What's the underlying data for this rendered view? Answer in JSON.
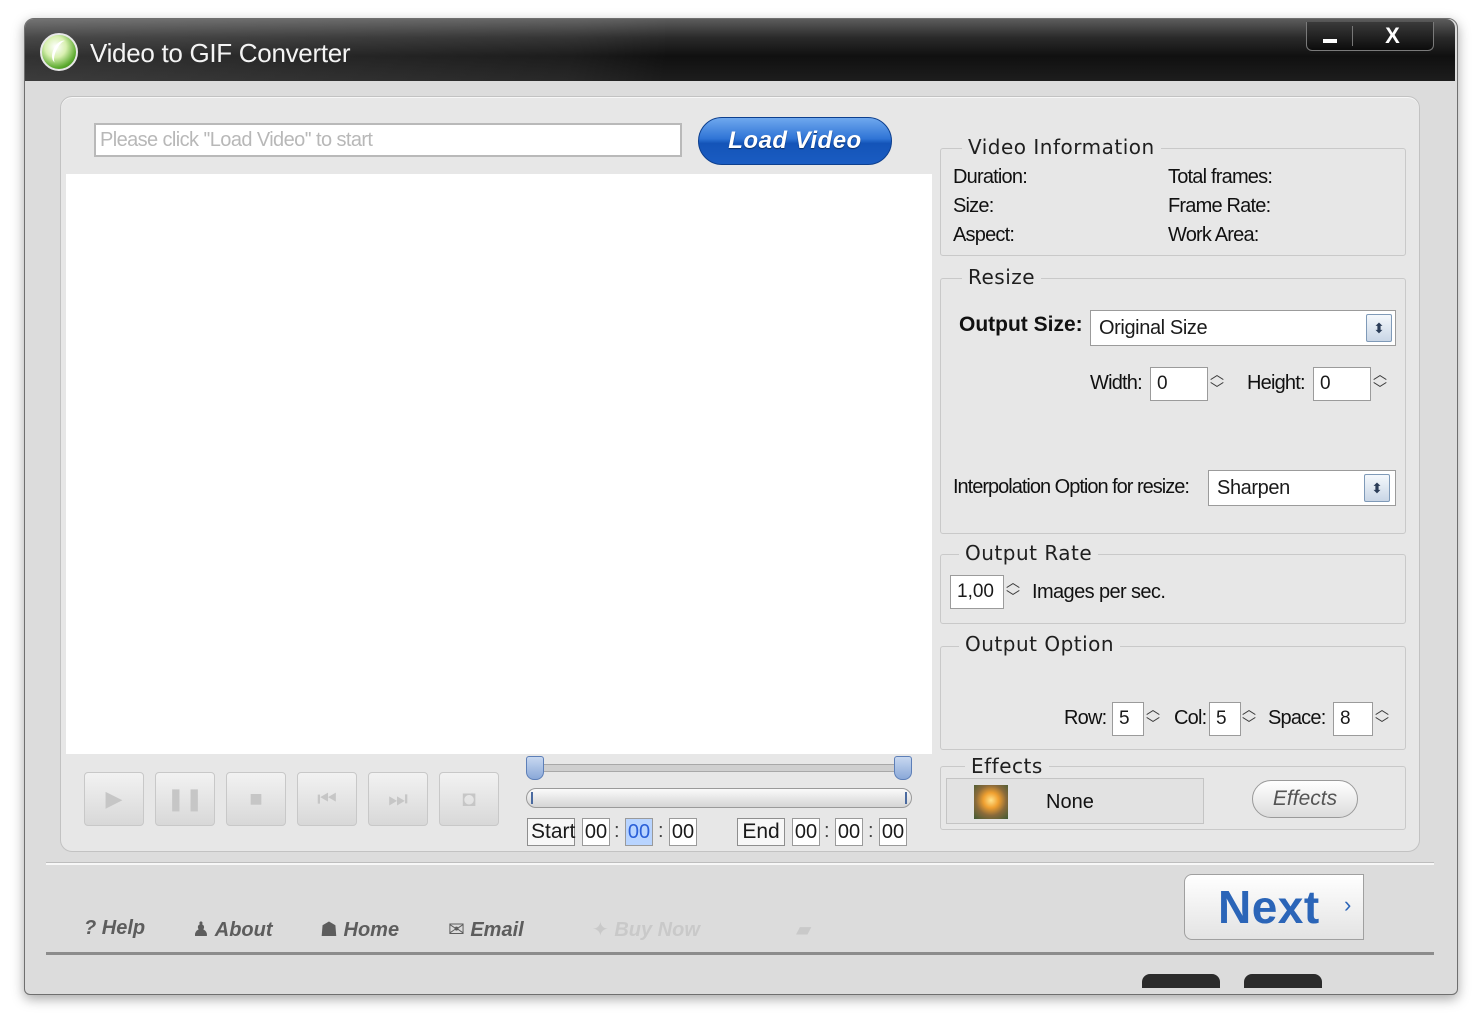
{
  "window": {
    "title": "Video to GIF Converter",
    "close_symbol": "X"
  },
  "toolbar": {
    "path_placeholder": "Please click ''Load Video'' to start",
    "load_button": "Load Video"
  },
  "playback": {
    "buttons": [
      "play-icon",
      "pause-icon",
      "stop-icon",
      "previous-frame-icon",
      "next-frame-icon",
      "snapshot-icon"
    ],
    "start_label": "Start",
    "end_label": "End",
    "start_time": [
      "00",
      "00",
      "00"
    ],
    "end_time": [
      "00",
      "00",
      "00"
    ]
  },
  "video_info": {
    "title": "Video Information",
    "duration": "Duration:",
    "size": "Size:",
    "aspect": "Aspect:",
    "total_frames": "Total frames:",
    "frame_rate": "Frame Rate:",
    "work_area": "Work Area:"
  },
  "resize": {
    "title": "Resize",
    "output_size_label": "Output Size:",
    "output_size_value": "Original Size",
    "width_label": "Width:",
    "width_value": "0",
    "height_label": "Height:",
    "height_value": "0",
    "interpolation_label": "Interpolation Option for resize:",
    "interpolation_value": "Sharpen"
  },
  "output_rate": {
    "title": "Output Rate",
    "value": "1,00",
    "unit": "Images per sec."
  },
  "output_option": {
    "title": "Output Option",
    "row_label": "Row:",
    "row_value": "5",
    "col_label": "Col:",
    "col_value": "5",
    "space_label": "Space:",
    "space_value": "8"
  },
  "effects": {
    "title": "Effects",
    "current": "None",
    "button": "Effects"
  },
  "footer": {
    "help": "Help",
    "about": "About",
    "home": "Home",
    "email": "Email",
    "buy_now": "Buy Now",
    "next": "Next"
  }
}
